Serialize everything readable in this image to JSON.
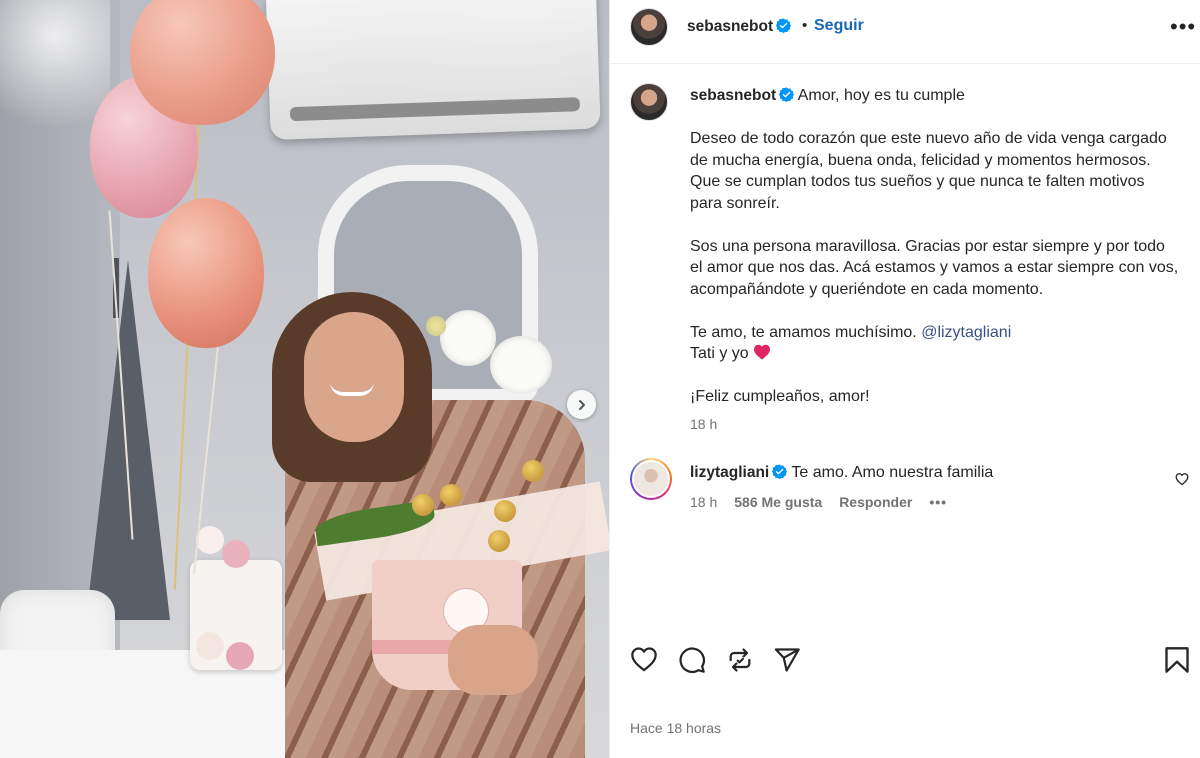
{
  "post": {
    "username": "sebasnebot",
    "follow_label": "Seguir",
    "separator": "•",
    "more_label": "•••",
    "caption": {
      "title": "Amor, hoy es tu cumple",
      "p1": "Deseo de todo corazón que este nuevo año de vida venga cargado de mucha energía, buena onda, felicidad y momentos hermosos. Que se cumplan todos tus sueños y que nunca te falten motivos para sonreír.",
      "p2": "Sos una persona maravillosa. Gracias por estar siempre y por todo el amor que nos das. Acá estamos y vamos a estar siempre con vos, acompañándote y queriéndote en cada momento.",
      "p3_line1": "Te amo, te amamos muchísimo.",
      "p3_mention": "@lizytagliani",
      "p3_line2": "Tati y yo",
      "p4": "¡Feliz cumpleaños, amor!"
    },
    "caption_time": "18 h",
    "posted_ago": "Hace 18 horas"
  },
  "comment": {
    "username": "lizytagliani",
    "text": "Te amo. Amo nuestra familia",
    "time": "18 h",
    "likes": "586 Me gusta",
    "reply_label": "Responder",
    "more_label": "•••"
  },
  "icons": {
    "verified": "verified-badge-icon",
    "next": "chevron-right-icon",
    "like": "heart-icon",
    "comment": "comment-icon",
    "repost": "repost-icon",
    "share": "send-icon",
    "save": "bookmark-icon"
  },
  "colors": {
    "follow": "#1a66b7",
    "verified": "#0095f6",
    "heart_emoji": "#e0245e",
    "muted": "#737373"
  }
}
